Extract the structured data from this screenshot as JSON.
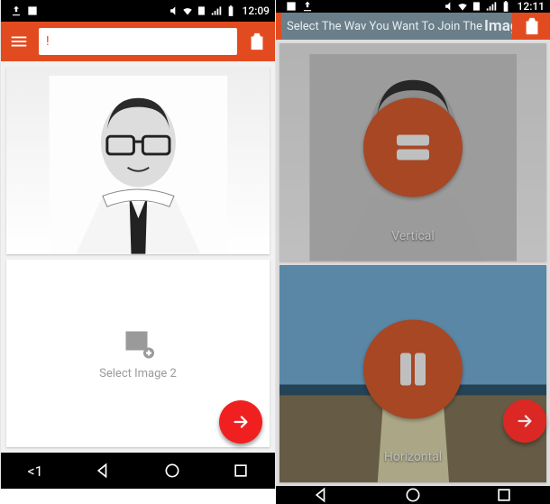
{
  "left": {
    "status": {
      "time": "12:09"
    },
    "search": {
      "placeholder": "!"
    },
    "select_label": "Select Image 2",
    "nav_back": "<1"
  },
  "right": {
    "status": {
      "time": "12:11"
    },
    "banner_prefix": "Select The Wav You Want To Join The",
    "banner_emph": "Imago",
    "options": {
      "vertical": "Vertical",
      "horizontal": "Horizontal"
    }
  },
  "colors": {
    "accent": "#e24b1f",
    "fab": "#f02020",
    "option": "#f15a24"
  }
}
